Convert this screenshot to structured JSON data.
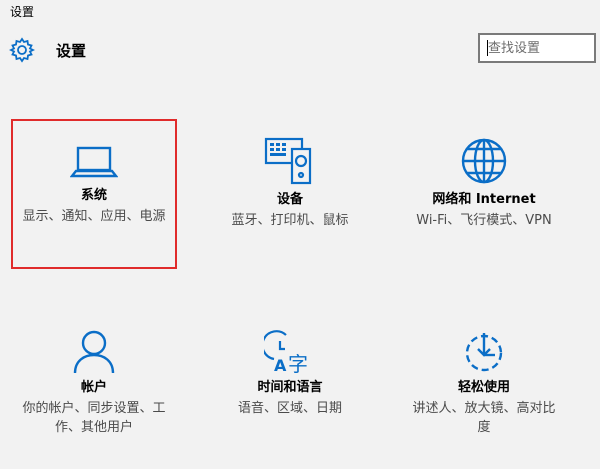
{
  "window": {
    "title": "设置"
  },
  "header": {
    "title": "设置",
    "icon": "gear-icon"
  },
  "search": {
    "placeholder": "查找设置",
    "value": ""
  },
  "colors": {
    "accent": "#0b6ec7",
    "selection_border": "#e02b2b"
  },
  "tiles": [
    {
      "id": "system",
      "icon": "laptop-icon",
      "name": "系统",
      "desc": "显示、通知、应用、电源"
    },
    {
      "id": "devices",
      "icon": "devices-icon",
      "name": "设备",
      "desc": "蓝牙、打印机、鼠标"
    },
    {
      "id": "network",
      "icon": "globe-icon",
      "name": "网络和 Internet",
      "desc": "Wi-Fi、飞行模式、VPN"
    },
    {
      "id": "accounts",
      "icon": "person-icon",
      "name": "帐户",
      "desc": "你的帐户、同步设置、工作、其他用户"
    },
    {
      "id": "time-language",
      "icon": "time-language-icon",
      "name": "时间和语言",
      "desc": "语音、区域、日期"
    },
    {
      "id": "ease-of-access",
      "icon": "ease-of-access-icon",
      "name": "轻松使用",
      "desc": "讲述人、放大镜、高对比度"
    }
  ]
}
